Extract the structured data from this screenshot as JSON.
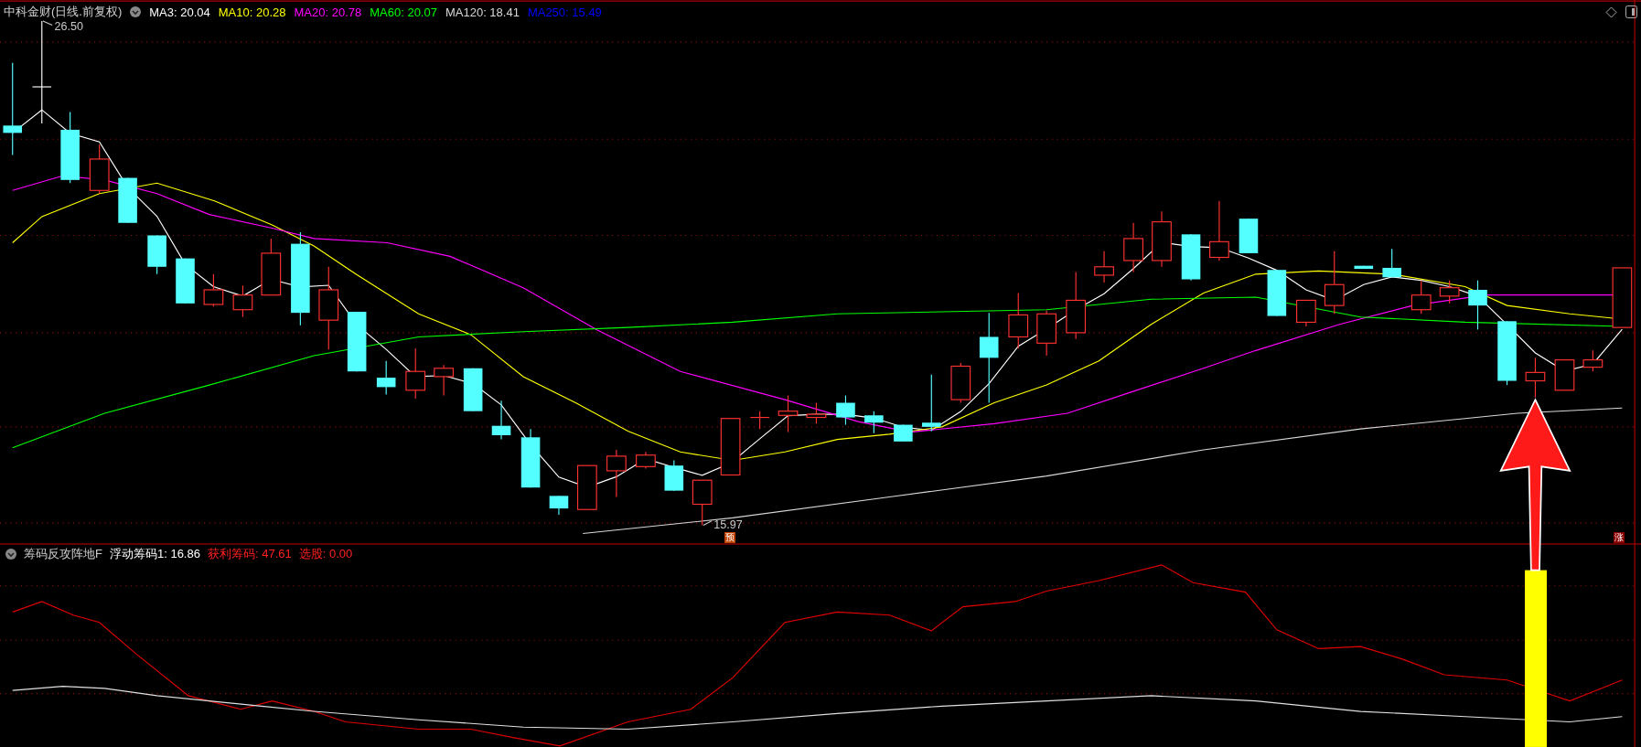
{
  "header": {
    "title": "中科金财(日线.前复权)",
    "ma_labels": [
      {
        "text": "MA3: 20.04",
        "color": "#ffffff"
      },
      {
        "text": "MA10: 20.28",
        "color": "#ffff00"
      },
      {
        "text": "MA20: 20.78",
        "color": "#ff00ff"
      },
      {
        "text": "MA60: 20.07",
        "color": "#00ff00"
      },
      {
        "text": "MA120: 18.41",
        "color": "#d8d8d8"
      },
      {
        "text": "MA250: 15.49",
        "color": "#0000ff"
      }
    ]
  },
  "price_labels": {
    "high": "26.50",
    "low": "15.97"
  },
  "markers": [
    "预",
    "涨"
  ],
  "indicator": {
    "name": "筹码反攻阵地F",
    "values": [
      {
        "text": "浮动筹码1: 16.86",
        "color": "#ffffff"
      },
      {
        "text": "获利筹码: 47.61",
        "color": "#ff2020"
      },
      {
        "text": "选股: 0.00",
        "color": "#ff2020"
      }
    ]
  }
}
